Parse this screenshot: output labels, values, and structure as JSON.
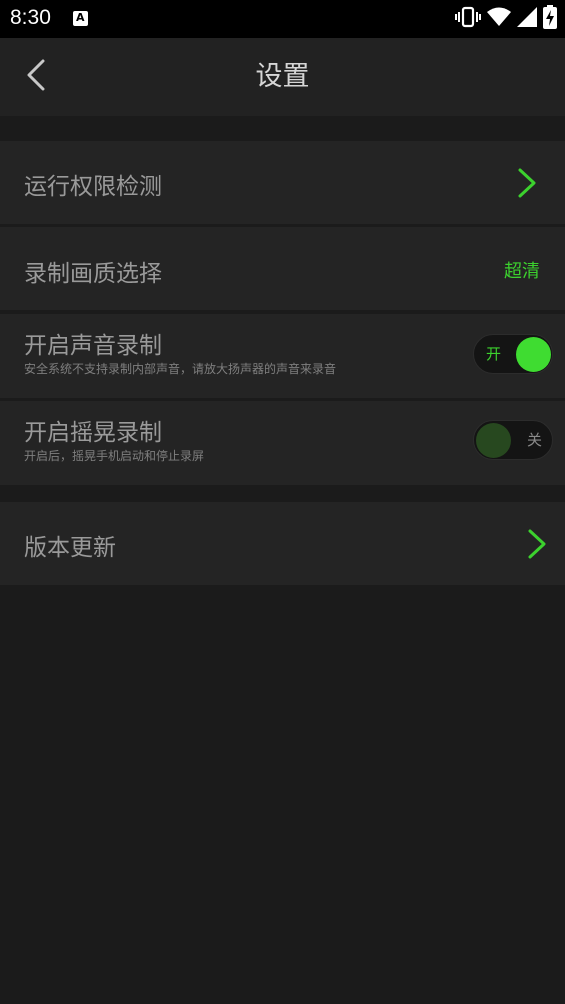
{
  "status_bar": {
    "time": "8:30",
    "notification_icon": "a-notification-icon",
    "icons": [
      "vibrate-icon",
      "wifi-icon",
      "signal-icon",
      "battery-charging-icon"
    ]
  },
  "header": {
    "title": "设置",
    "back_icon": "chevron-left-icon"
  },
  "settings": {
    "permission_check": {
      "label": "运行权限检测"
    },
    "record_quality": {
      "label": "录制画质选择",
      "value": "超清"
    },
    "sound_record": {
      "label": "开启声音录制",
      "description": "安全系统不支持录制内部声音，请放大扬声器的声音来录音",
      "toggle_text": "开",
      "enabled": true
    },
    "shake_record": {
      "label": "开启摇晃录制",
      "description": "开启后，摇晃手机启动和停止录屏",
      "toggle_text": "关",
      "enabled": false
    },
    "version_update": {
      "label": "版本更新"
    }
  },
  "colors": {
    "accent": "#3cd12e",
    "background": "#1b1b1b",
    "row": "#242424"
  }
}
